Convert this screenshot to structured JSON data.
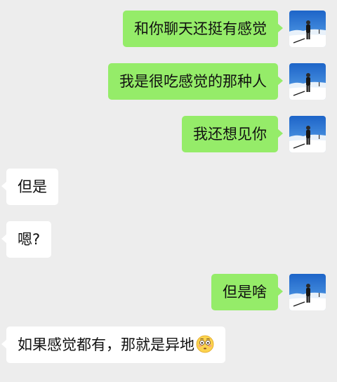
{
  "messages": [
    {
      "side": "sent",
      "text": "和你聊天还挺有感觉"
    },
    {
      "side": "sent",
      "text": "我是很吃感觉的那种人"
    },
    {
      "side": "sent",
      "text": "我还想见你"
    },
    {
      "side": "received",
      "text": "但是"
    },
    {
      "side": "received",
      "text": "嗯?"
    },
    {
      "side": "sent",
      "text": "但是啥"
    },
    {
      "side": "received",
      "text": "如果感觉都有，那就是异地",
      "emoji": "flushed-face"
    }
  ],
  "avatar": {
    "icon": "snow-portrait-avatar"
  },
  "colors": {
    "background": "#ededed",
    "sent_bubble": "#95ec69",
    "received_bubble": "#ffffff"
  }
}
